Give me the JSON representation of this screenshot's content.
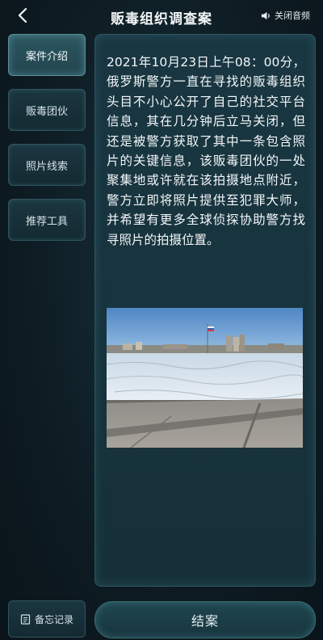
{
  "header": {
    "title": "贩毒组织调查案",
    "back_icon": "chevron-left-icon",
    "audio_icon": "speaker-icon",
    "audio_label": "关闭音频"
  },
  "sidebar": {
    "items": [
      {
        "label": "案件介绍",
        "active": true
      },
      {
        "label": "贩毒团伙",
        "active": false
      },
      {
        "label": "照片线索",
        "active": false
      },
      {
        "label": "推荐工具",
        "active": false
      }
    ]
  },
  "content": {
    "case_text": "2021年10月23日上午08：00分，俄罗斯警方一直在寻找的贩毒组织头目不小心公开了自己的社交平台信息，其在几分钟后立马关闭，但还是被警方获取了其中一条包含照片的关键信息，该贩毒团伙的一处聚集地或许就在该拍摄地点附近，警方立即将照片提供至犯罪大师，并希望有更多全球侦探协助警方找寻照片的拍摄位置。",
    "photo_icon": "river-photo"
  },
  "footer": {
    "memo_label": "备忘记录",
    "memo_icon": "notepad-icon",
    "close_case_label": "结案"
  },
  "colors": {
    "background": "#0f1c24",
    "panel": "#193742",
    "border": "#2e5560",
    "text": "#f3f7f8"
  }
}
